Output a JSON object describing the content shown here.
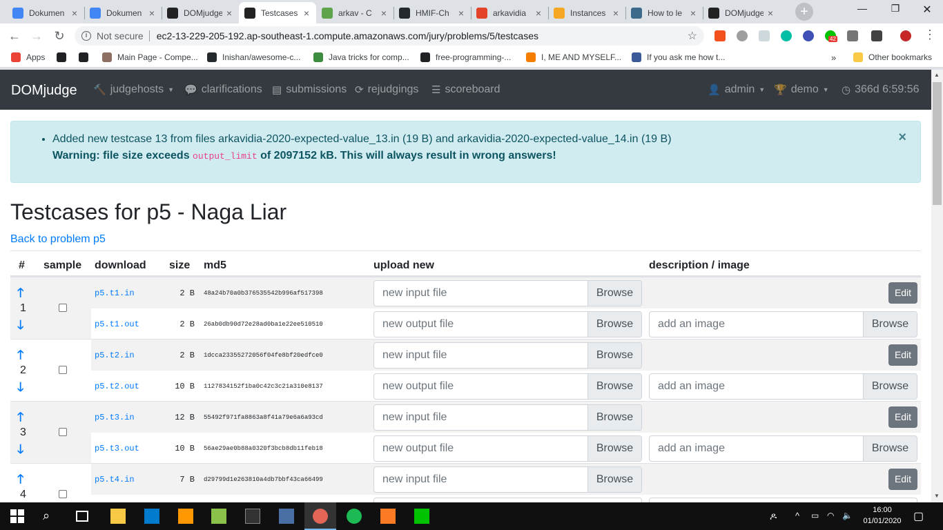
{
  "browser": {
    "tabs": [
      {
        "label": "Dokumen",
        "icon": "docs-icon",
        "color": "#4285f4"
      },
      {
        "label": "Dokumen",
        "icon": "docs-icon",
        "color": "#4285f4"
      },
      {
        "label": "DOMjudge",
        "icon": "domjudge-icon",
        "color": "#222222"
      },
      {
        "label": "Testcases",
        "icon": "domjudge-icon",
        "color": "#222222",
        "active": true
      },
      {
        "label": "arkav - C",
        "icon": "link-icon",
        "color": "#5fa34a"
      },
      {
        "label": "HMIF-Ch",
        "icon": "github-icon",
        "color": "#24292e"
      },
      {
        "label": "arkavidia",
        "icon": "gitlab-icon",
        "color": "#e24329"
      },
      {
        "label": "Instances",
        "icon": "aws-icon",
        "color": "#f5a623"
      },
      {
        "label": "How to le",
        "icon": "web-icon",
        "color": "#3d6a8b"
      },
      {
        "label": "DOMjudge",
        "icon": "domjudge-icon",
        "color": "#222222"
      }
    ],
    "security_label": "Not secure",
    "url": "ec2-13-229-205-192.ap-southeast-1.compute.amazonaws.com/jury/problems/5/testcases",
    "bookmarks": [
      {
        "label": "Apps",
        "color": "#ea4335"
      },
      {
        "label": "",
        "color": "#202124"
      },
      {
        "label": "",
        "color": "#202124"
      },
      {
        "label": "Main Page - Compe...",
        "color": "#8d6e63"
      },
      {
        "label": "Inishan/awesome-c...",
        "color": "#24292e"
      },
      {
        "label": "Java tricks for comp...",
        "color": "#3c8d40"
      },
      {
        "label": "free-programming-...",
        "color": "#202124"
      },
      {
        "label": "I, ME AND MYSELF...",
        "color": "#f57d00"
      },
      {
        "label": "If you ask me how t...",
        "color": "#3b5998"
      }
    ],
    "other_bookmarks": "Other bookmarks",
    "ext_badge": "42"
  },
  "navbar": {
    "brand": "DOMjudge",
    "items": [
      {
        "label": "judgehosts",
        "icon": "hammer-icon",
        "dropdown": true
      },
      {
        "label": "clarifications",
        "icon": "comments-icon"
      },
      {
        "label": "submissions",
        "icon": "file-code-icon"
      },
      {
        "label": "rejudgings",
        "icon": "sync-icon"
      },
      {
        "label": "scoreboard",
        "icon": "list-icon"
      }
    ],
    "user": "admin",
    "contest": "demo",
    "time_remaining": "366d 6:59:56"
  },
  "alert": {
    "line1": "Added new testcase 13 from files arkavidia-2020-expected-value_13.in (19 B) and arkavidia-2020-expected-value_14.in (19 B)",
    "warn_pre": "Warning: file size exceeds",
    "warn_code": "output_limit",
    "warn_post": "of 2097152 kB. This will always result in wrong answers!",
    "close": "×"
  },
  "page": {
    "title": "Testcases for p5 - Naga Liar",
    "back_link": "Back to problem p5"
  },
  "table": {
    "headers": {
      "rank": "#",
      "sample": "sample",
      "download": "download",
      "size": "size",
      "md5": "md5",
      "upload": "upload new",
      "desc": "description / image"
    },
    "placeholder_input": "new input file",
    "placeholder_output": "new output file",
    "placeholder_image": "add an image",
    "browse": "Browse",
    "edit": "Edit",
    "rows": [
      {
        "rank": "1",
        "in_file": "p5.t1.in",
        "in_size": "2 B",
        "in_md5": "48a24b70a0b376535542b996af517398",
        "out_file": "p5.t1.out",
        "out_size": "2 B",
        "out_md5": "26ab0db90d72e28ad0ba1e22ee510510"
      },
      {
        "rank": "2",
        "in_file": "p5.t2.in",
        "in_size": "2 B",
        "in_md5": "1dcca23355272056f04fe8bf20edfce0",
        "out_file": "p5.t2.out",
        "out_size": "10 B",
        "out_md5": "1127834152f1ba0c42c3c21a310e8137"
      },
      {
        "rank": "3",
        "in_file": "p5.t3.in",
        "in_size": "12 B",
        "in_md5": "55492f971fa8863a8f41a79e6a6a93cd",
        "out_file": "p5.t3.out",
        "out_size": "10 B",
        "out_md5": "56ae29ae0b88a0320f3bcb8db11feb18"
      },
      {
        "rank": "4",
        "in_file": "p5.t4.in",
        "in_size": "7 B",
        "in_md5": "d29799d1e263810a4db7bbf43ca66499"
      }
    ]
  },
  "taskbar": {
    "time": "16:00",
    "date": "01/01/2020"
  }
}
